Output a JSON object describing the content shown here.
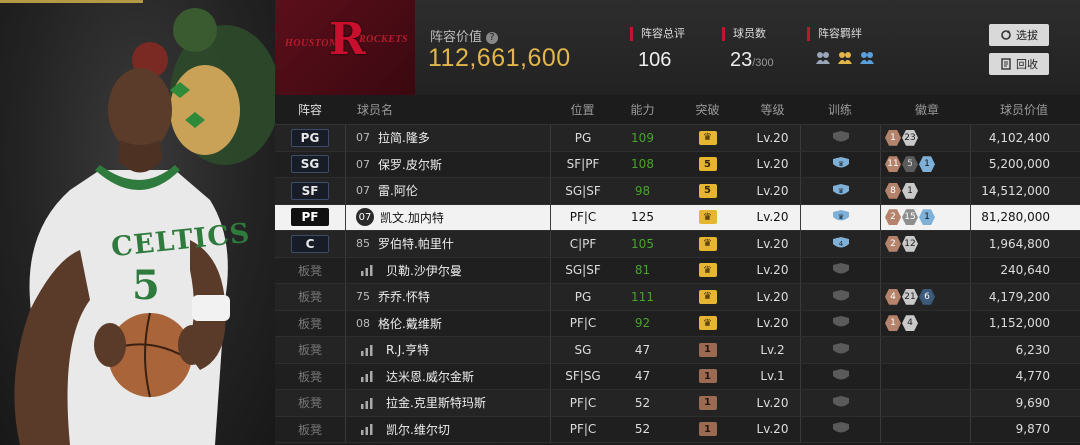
{
  "header": {
    "team_left": "HOUSTON",
    "team_right": "ROCKETS",
    "value_label": "阵容价值",
    "value_help": "?",
    "value_amount": "112,661,600",
    "stats": [
      {
        "label": "阵容总评",
        "value": "106",
        "suffix": ""
      },
      {
        "label": "球员数",
        "value": "23",
        "suffix": "/300"
      },
      {
        "label": "阵容羁绊",
        "value": "",
        "suffix": ""
      }
    ],
    "buttons": {
      "select": "选拔",
      "recycle": "回收"
    }
  },
  "columns": [
    "阵容",
    "球员名",
    "位置",
    "能力",
    "突破",
    "等级",
    "训练",
    "徽章",
    "球员价值"
  ],
  "rows": [
    {
      "slot": "PG",
      "num": "07",
      "name": "拉简.隆多",
      "pos": "PG",
      "ability": "109",
      "ability_green": true,
      "breakthrough": "crown",
      "level": "Lv.20",
      "train": "gray",
      "badges": [
        {
          "t": "br",
          "v": "1"
        },
        {
          "t": "si",
          "v": "23"
        }
      ],
      "value": "4,102,400"
    },
    {
      "slot": "SG",
      "num": "07",
      "name": "保罗.皮尔斯",
      "pos": "SF|PF",
      "ability": "108",
      "ability_green": true,
      "breakthrough": "5",
      "level": "Lv.20",
      "train": "blue",
      "badges": [
        {
          "t": "br",
          "v": "11"
        },
        {
          "t": "gr",
          "v": "5"
        },
        {
          "t": "bl",
          "v": "1"
        }
      ],
      "value": "5,200,000"
    },
    {
      "slot": "SF",
      "num": "07",
      "name": "雷.阿伦",
      "pos": "SG|SF",
      "ability": "98",
      "ability_green": true,
      "breakthrough": "5",
      "level": "Lv.20",
      "train": "blue",
      "badges": [
        {
          "t": "br",
          "v": "8"
        },
        {
          "t": "si",
          "v": "1"
        }
      ],
      "value": "14,512,000"
    },
    {
      "slot": "PF",
      "num": "07",
      "name": "凯文.加内特",
      "pos": "PF|C",
      "ability": "125",
      "ability_green": false,
      "breakthrough": "crown",
      "level": "Lv.20",
      "train": "blue",
      "badges": [
        {
          "t": "br",
          "v": "2"
        },
        {
          "t": "gl",
          "v": "15"
        },
        {
          "t": "bl",
          "v": "1"
        }
      ],
      "value": "81,280,000",
      "selected": true
    },
    {
      "slot": "C",
      "num": "85",
      "name": "罗伯特.帕里什",
      "pos": "C|PF",
      "ability": "105",
      "ability_green": true,
      "breakthrough": "crown",
      "level": "Lv.20",
      "train": "blue4",
      "badges": [
        {
          "t": "br",
          "v": "2"
        },
        {
          "t": "si",
          "v": "12"
        }
      ],
      "value": "1,964,800"
    },
    {
      "slot": "板凳",
      "num": "",
      "name": "贝勒.沙伊尔曼",
      "pos": "SG|SF",
      "ability": "81",
      "ability_green": true,
      "breakthrough": "crown",
      "level": "Lv.20",
      "train": "gray",
      "badges": [],
      "value": "240,640"
    },
    {
      "slot": "板凳",
      "num": "75",
      "name": "乔乔.怀特",
      "pos": "PG",
      "ability": "111",
      "ability_green": true,
      "breakthrough": "crown",
      "level": "Lv.20",
      "train": "gray",
      "badges": [
        {
          "t": "br",
          "v": "4"
        },
        {
          "t": "si",
          "v": "21"
        },
        {
          "t": "nv",
          "v": "6"
        }
      ],
      "value": "4,179,200"
    },
    {
      "slot": "板凳",
      "num": "08",
      "name": "格伦.戴维斯",
      "pos": "PF|C",
      "ability": "92",
      "ability_green": true,
      "breakthrough": "crown",
      "level": "Lv.20",
      "train": "gray",
      "badges": [
        {
          "t": "br",
          "v": "1"
        },
        {
          "t": "si",
          "v": "4"
        }
      ],
      "value": "1,152,000"
    },
    {
      "slot": "板凳",
      "num": "",
      "name": "R.J.亨特",
      "pos": "SG",
      "ability": "47",
      "ability_green": false,
      "breakthrough": "1",
      "level": "Lv.2",
      "train": "gray",
      "badges": [],
      "value": "6,230"
    },
    {
      "slot": "板凳",
      "num": "",
      "name": "达米恩.威尔金斯",
      "pos": "SF|SG",
      "ability": "47",
      "ability_green": false,
      "breakthrough": "1",
      "level": "Lv.1",
      "train": "gray",
      "badges": [],
      "value": "4,770"
    },
    {
      "slot": "板凳",
      "num": "",
      "name": "拉金.克里斯特玛斯",
      "pos": "PF|C",
      "ability": "52",
      "ability_green": false,
      "breakthrough": "1",
      "level": "Lv.20",
      "train": "gray",
      "badges": [],
      "value": "9,690"
    },
    {
      "slot": "板凳",
      "num": "",
      "name": "凯尔.维尔切",
      "pos": "PF|C",
      "ability": "52",
      "ability_green": false,
      "breakthrough": "1",
      "level": "Lv.20",
      "train": "gray",
      "badges": [],
      "value": "9,870"
    }
  ],
  "player_art": {
    "jersey_text": "CELTICS",
    "jersey_number": "5"
  }
}
